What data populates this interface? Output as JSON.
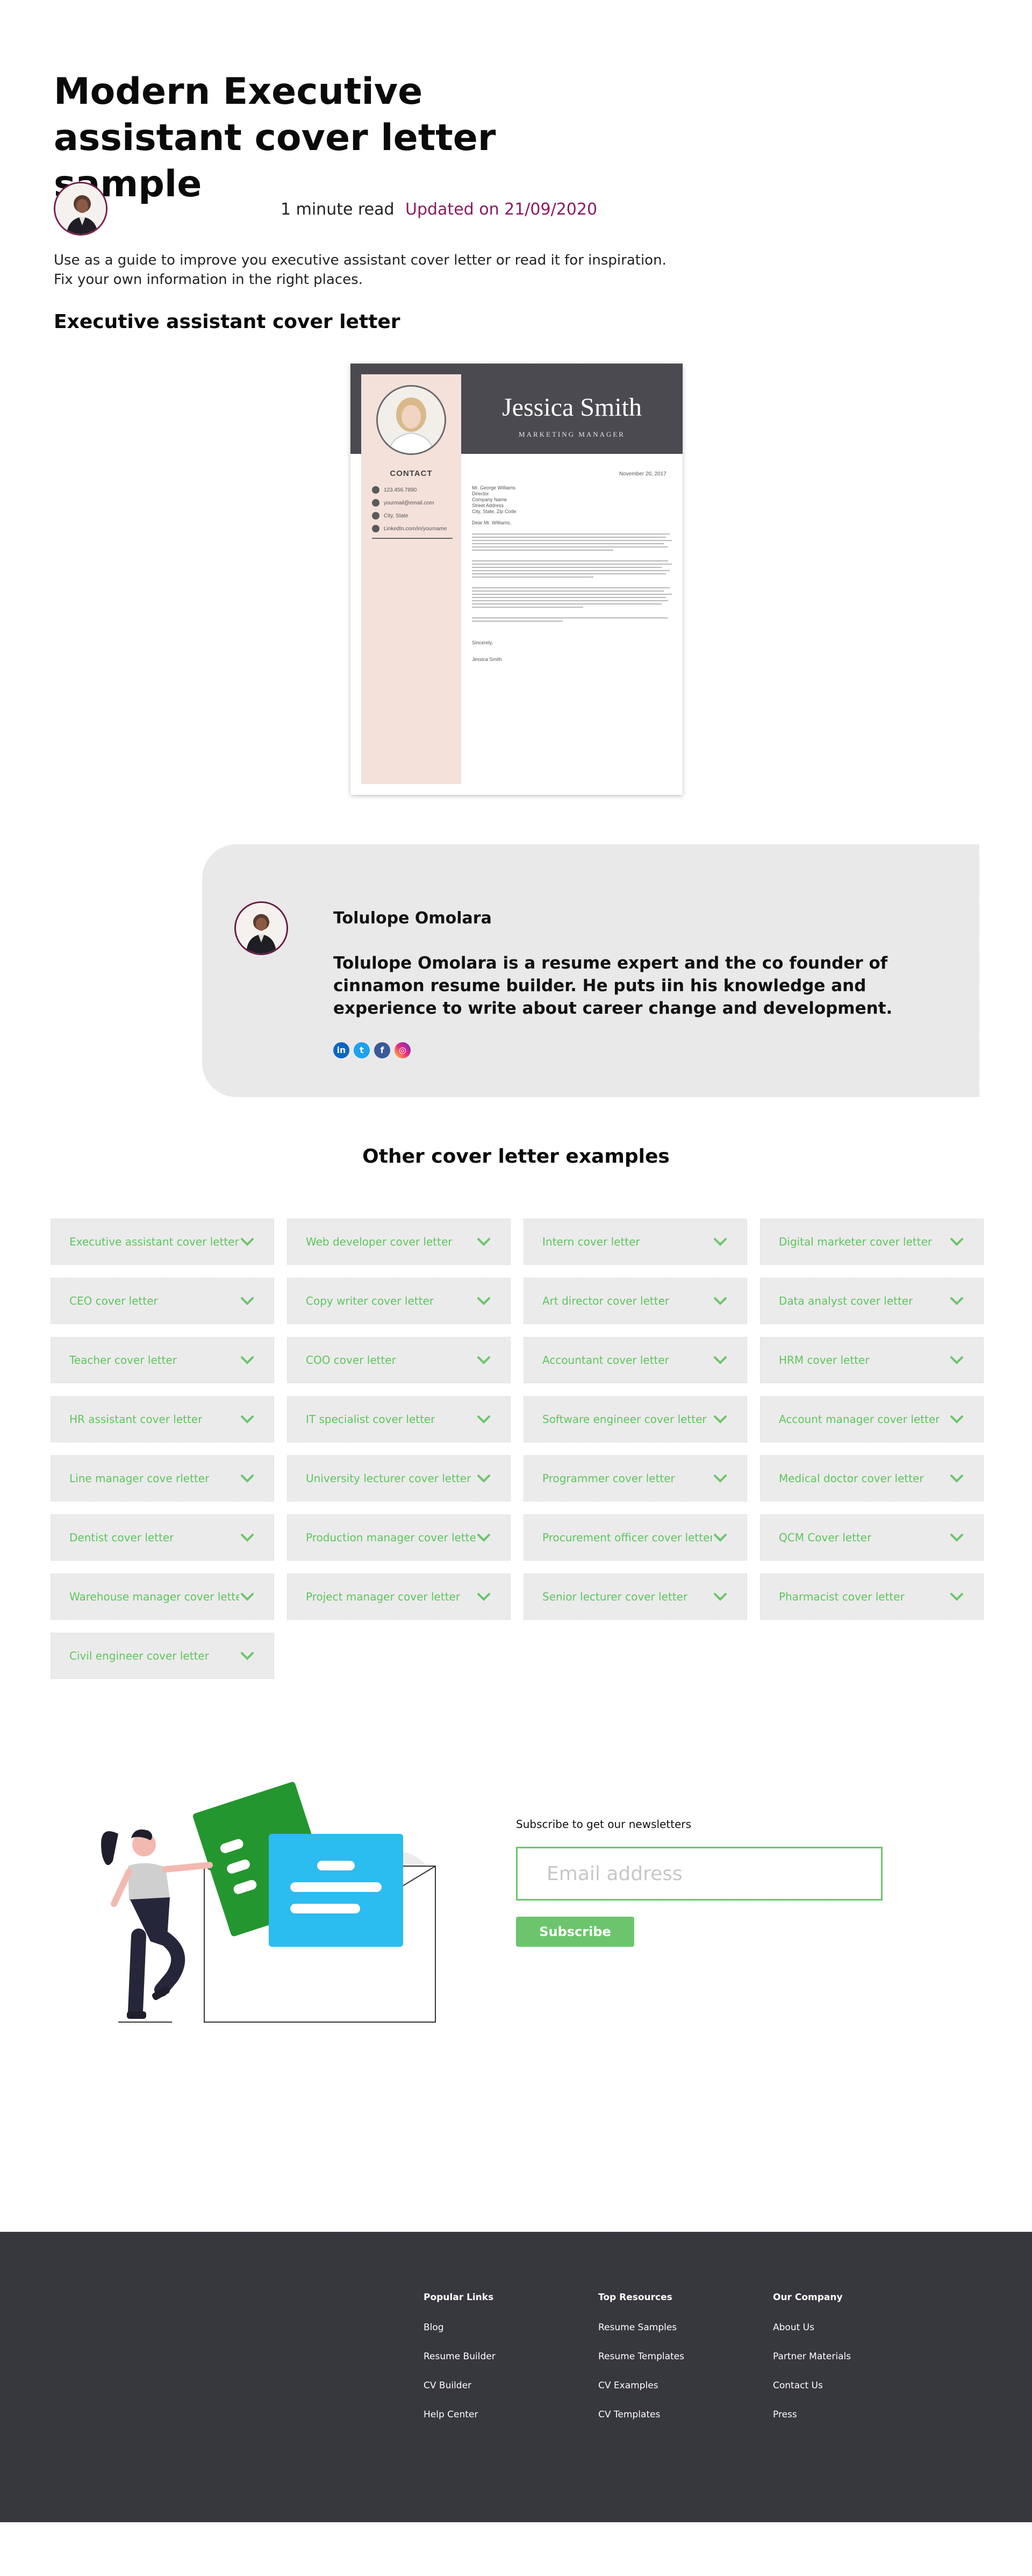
{
  "header": {
    "title": "Modern Executive assistant cover letter sample",
    "read_time": "1 minute read",
    "updated": "Updated on 21/09/2020",
    "intro_line1": "Use as a guide to improve you executive assistant cover letter or read it for inspiration.",
    "intro_line2": "Fix your own information in the right places.",
    "section_heading": "Executive assistant cover letter"
  },
  "resume": {
    "name": "Jessica Smith",
    "role": "MARKETING MANAGER",
    "contact_title": "CONTACT",
    "contacts": [
      "123.456.7890",
      "yourmail@email.com",
      "City, State",
      "LinkedIn.com/in/yourname"
    ],
    "date": "November 20, 2017",
    "recipient": [
      "Mr. George Williams",
      "Director",
      "Company Name",
      "Street Address",
      "City, State, Zip Code"
    ],
    "salutation": "Dear Mr. Williams,",
    "closing": "Sincerely,",
    "signature": "Jessica Smith"
  },
  "author": {
    "name": "Tolulope Omolara",
    "bio": "Tolulope Omolara is a resume expert and the co founder of cinnamon resume builder. He puts iin his knowledge and experience to write about career change and development.",
    "social": [
      "linkedin-icon",
      "twitter-icon",
      "facebook-icon",
      "instagram-icon"
    ]
  },
  "others": {
    "heading": "Other cover letter examples",
    "items": [
      "Executive assistant cover letter",
      "Web developer cover letter",
      "Intern cover letter",
      "Digital marketer cover letter",
      "CEO cover letter",
      "Copy writer cover letter",
      "Art director cover letter",
      "Data analyst cover letter",
      "Teacher cover letter",
      "COO cover letter",
      "Accountant cover letter",
      "HRM cover letter",
      "HR assistant cover letter",
      "IT specialist cover letter",
      "Software engineer cover letter",
      "Account manager cover letter",
      "Line manager cove rletter",
      "University lecturer cover letter",
      "Programmer cover letter",
      "Medical doctor cover letter",
      "Dentist cover letter",
      "Production manager cover letter",
      "Procurement officer cover letter",
      "QCM Cover letter",
      "Warehouse manager cover letter",
      "Project manager cover letter",
      "Senior lecturer cover letter",
      "Pharmacist cover letter",
      "Civil engineer cover letter"
    ]
  },
  "newsletter": {
    "label": "Subscribe to get our newsletters",
    "placeholder": "Email address",
    "button": "Subscribe"
  },
  "footer": {
    "columns": [
      {
        "title": "Popular Links",
        "links": [
          "Blog",
          "Resume Builder",
          "CV Builder",
          "Help Center"
        ]
      },
      {
        "title": "Top Resources",
        "links": [
          "Resume Samples",
          "Resume Templates",
          "CV Examples",
          "CV Templates"
        ]
      },
      {
        "title": "Our Company",
        "links": [
          "About Us",
          "Partner Materials",
          "Contact Us",
          "Press"
        ]
      }
    ]
  },
  "colors": {
    "accent_green": "#6cc56c",
    "updated_purple": "#8a1a62",
    "footer_bg": "#37373e"
  }
}
